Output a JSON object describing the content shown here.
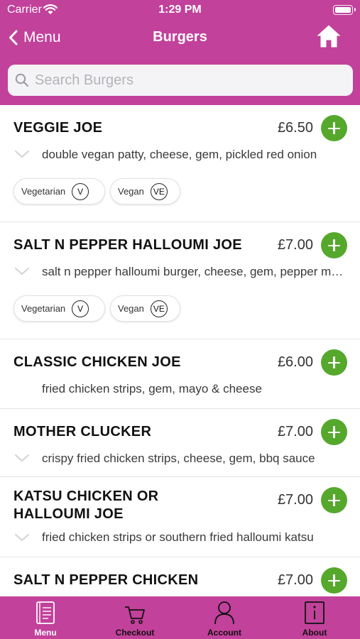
{
  "status_bar": {
    "carrier": "Carrier",
    "time": "1:29 PM"
  },
  "nav": {
    "back_label": "Menu",
    "title": "Burgers"
  },
  "search": {
    "placeholder": "Search Burgers"
  },
  "colors": {
    "brand": "#c2419a",
    "add_button": "#55a82c"
  },
  "items": [
    {
      "name": "VEGGIE JOE",
      "price": "£6.50",
      "description": "double vegan patty, cheese, gem, pickled red onion",
      "expandable": true,
      "tags": [
        {
          "label": "Vegetarian",
          "badge": "V"
        },
        {
          "label": "Vegan",
          "badge": "VE"
        }
      ]
    },
    {
      "name": "SALT N PEPPER HALLOUMI JOE",
      "price": "£7.00",
      "description": "salt n pepper halloumi burger, cheese, gem, pepper mayo",
      "expandable": true,
      "tags": [
        {
          "label": "Vegetarian",
          "badge": "V"
        },
        {
          "label": "Vegan",
          "badge": "VE"
        }
      ]
    },
    {
      "name": "CLASSIC CHICKEN JOE",
      "price": "£6.00",
      "description": "fried chicken strips, gem, mayo & cheese",
      "expandable": false,
      "tags": []
    },
    {
      "name": "MOTHER CLUCKER",
      "price": "£7.00",
      "description": "crispy fried chicken strips, cheese, gem, bbq sauce",
      "expandable": true,
      "tags": []
    },
    {
      "name": "KATSU CHICKEN OR HALLOUMI JOE",
      "price": "£7.00",
      "description": "fried chicken strips or southern fried halloumi katsu",
      "expandable": true,
      "tags": []
    },
    {
      "name": "SALT N PEPPER CHICKEN",
      "price": "£7.00",
      "description": "",
      "expandable": false,
      "tags": []
    }
  ],
  "tabs": [
    {
      "label": "Menu",
      "icon": "menu-book-icon",
      "active": true
    },
    {
      "label": "Checkout",
      "icon": "cart-icon",
      "active": false
    },
    {
      "label": "Account",
      "icon": "person-icon",
      "active": false
    },
    {
      "label": "About",
      "icon": "info-icon",
      "active": false
    }
  ]
}
